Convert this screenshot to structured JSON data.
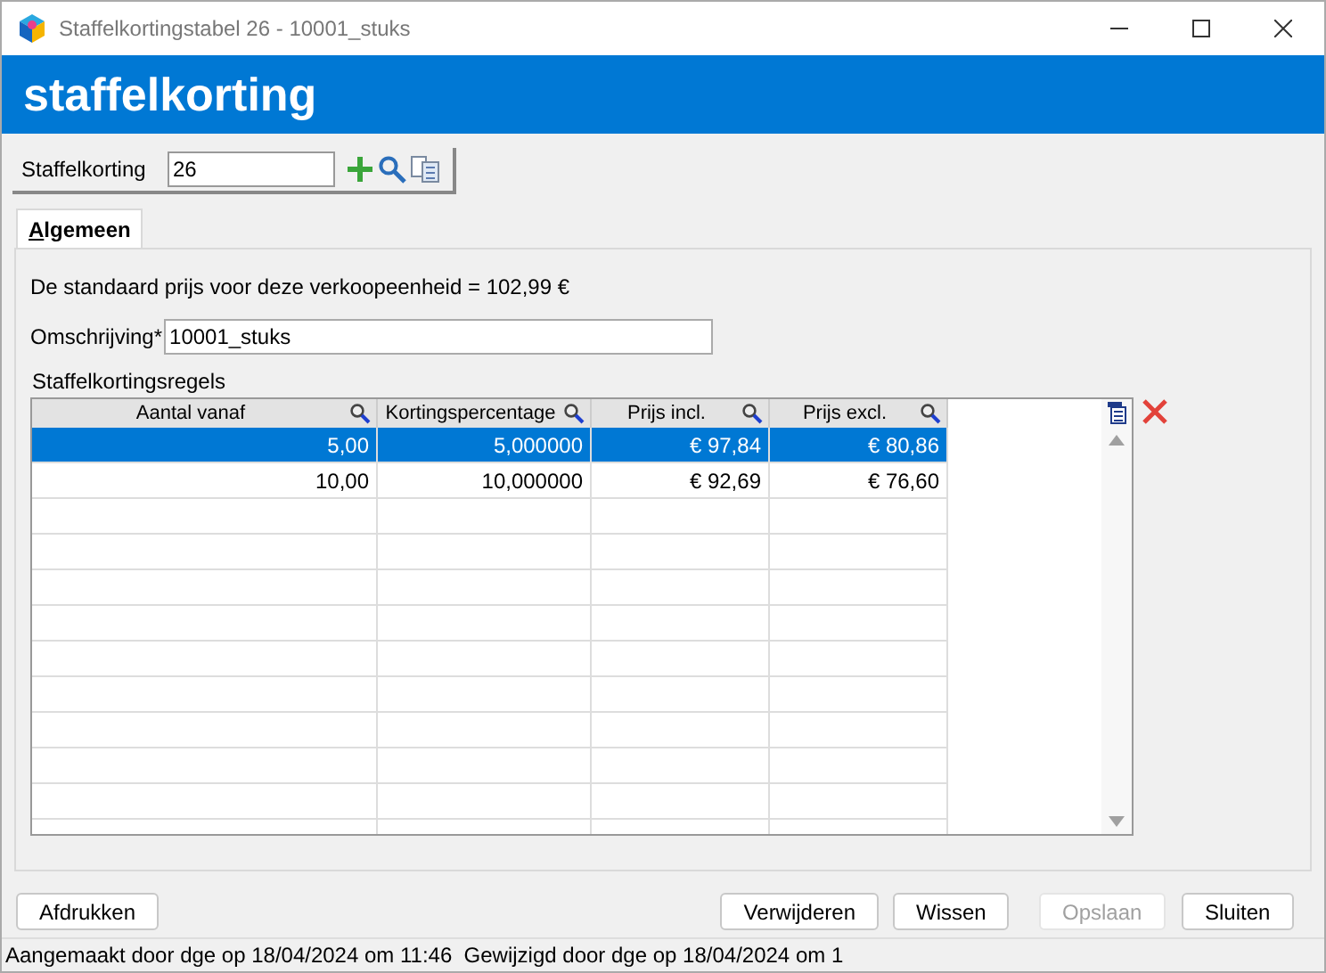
{
  "window": {
    "title": "Staffelkortingstabel 26 - 10001_stuks"
  },
  "header": "staffelkorting",
  "toolbar": {
    "label": "Staffelkorting",
    "value": "26"
  },
  "tabs": [
    {
      "label": "Algemeen",
      "selected": true
    }
  ],
  "info": "De standaard prijs voor deze verkoopeenheid = 102,99 €",
  "description": {
    "label": "Omschrijving*",
    "value": "10001_stuks"
  },
  "grid": {
    "title": "Staffelkortingsregels",
    "columns": [
      "Aantal vanaf",
      "Kortingspercentage",
      "Prijs incl.",
      "Prijs excl."
    ],
    "rows": [
      {
        "cells": [
          "5,00",
          "5,000000",
          "€ 97,84",
          "€ 80,86"
        ],
        "selected": true
      },
      {
        "cells": [
          "10,00",
          "10,000000",
          "€ 92,69",
          "€ 76,60"
        ],
        "selected": false
      }
    ]
  },
  "buttons": [
    {
      "label": "Afdrukken",
      "disabled": false
    },
    {
      "label": "Verwijderen",
      "disabled": false
    },
    {
      "label": "Wissen",
      "disabled": false
    },
    {
      "label": "Opslaan",
      "disabled": true
    },
    {
      "label": "Sluiten",
      "disabled": false
    }
  ],
  "status_bar": "Aangemaakt door dge op 18/04/2024 om 11:46  Gewijzigd door dge op 18/04/2024 om 1"
}
